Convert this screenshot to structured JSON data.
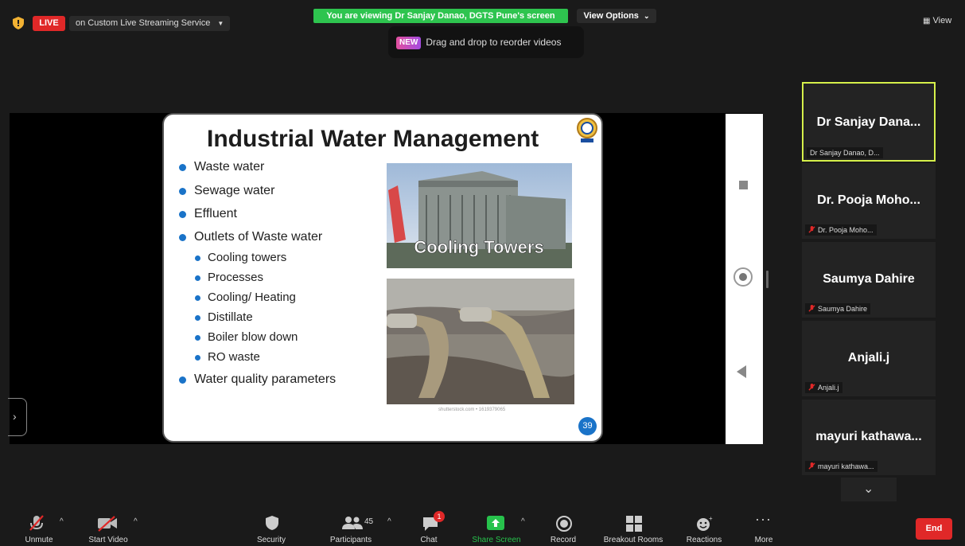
{
  "top": {
    "live_label": "LIVE",
    "stream_label": "on Custom Live Streaming Service",
    "viewing_banner": "You are viewing Dr Sanjay Danao, DGTS Pune's screen",
    "view_options": "View Options",
    "tip_badge": "NEW",
    "tip_text": "Drag and drop to reorder videos",
    "view_button": "View"
  },
  "slide": {
    "title": "Industrial Water Management",
    "bullets": [
      "Waste water",
      "Sewage water",
      "Effluent",
      "Outlets of Waste water"
    ],
    "sub_bullets": [
      "Cooling towers",
      "Processes",
      "Cooling/ Heating",
      "Distillate",
      "Boiler blow down",
      "RO waste"
    ],
    "last_bullet": "Water quality parameters",
    "image_caption": "Cooling Towers",
    "credit": "shutterstock.com • 1619379065",
    "page_number": "39"
  },
  "participants": [
    {
      "name": "Dr Sanjay Dana...",
      "label": "Dr Sanjay Danao, D...",
      "active": true,
      "muted": false
    },
    {
      "name": "Dr. Pooja Moho...",
      "label": "Dr. Pooja Moho...",
      "active": false,
      "muted": true
    },
    {
      "name": "Saumya Dahire",
      "label": "Saumya Dahire",
      "active": false,
      "muted": true
    },
    {
      "name": "Anjali.j",
      "label": "Anjali.j",
      "active": false,
      "muted": true
    },
    {
      "name": "mayuri  kathawa...",
      "label": "mayuri kathawa...",
      "active": false,
      "muted": true
    }
  ],
  "toolbar": {
    "unmute": "Unmute",
    "start_video": "Start Video",
    "security": "Security",
    "participants": "Participants",
    "participants_count": "45",
    "chat": "Chat",
    "chat_badge": "1",
    "share_screen": "Share Screen",
    "record": "Record",
    "breakout_rooms": "Breakout Rooms",
    "reactions": "Reactions",
    "more": "More",
    "end": "End"
  },
  "colors": {
    "live_red": "#e02828",
    "banner_green": "#2ec44f",
    "active_speaker": "#d6f04a",
    "bullet_blue": "#1a73c8",
    "share_green": "#27c24c"
  }
}
